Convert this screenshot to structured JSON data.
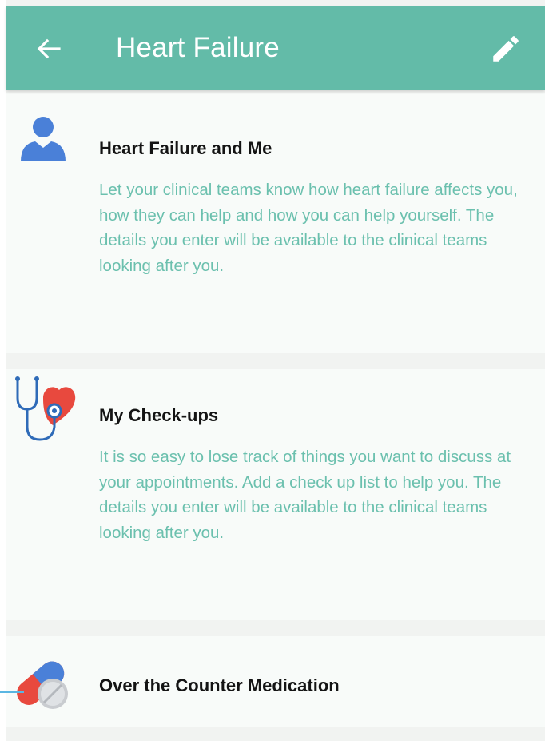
{
  "header": {
    "title": "Heart Failure",
    "back_icon": "arrow-left-icon",
    "edit_icon": "pencil-icon",
    "background_color": "#63bba8"
  },
  "cards": [
    {
      "icon": "person-icon",
      "title": "Heart Failure and Me",
      "description": "Let your clinical teams know how heart failure affects you, how they can help and how you can help yourself.  The details you enter will be available to the clinical teams looking after you."
    },
    {
      "icon": "stethoscope-heart-icon",
      "title": "My Check-ups",
      "description": "It is so easy to lose track of things you want to discuss at your appointments. Add a check up list to help you. The details you enter will be available to the clinical teams looking after you."
    },
    {
      "icon": "pills-icon",
      "title": "Over the Counter Medication"
    }
  ],
  "colors": {
    "accent": "#63bba8",
    "description_text": "#6bc0ae",
    "icon_blue": "#4a80d8",
    "icon_red": "#e8493e"
  }
}
